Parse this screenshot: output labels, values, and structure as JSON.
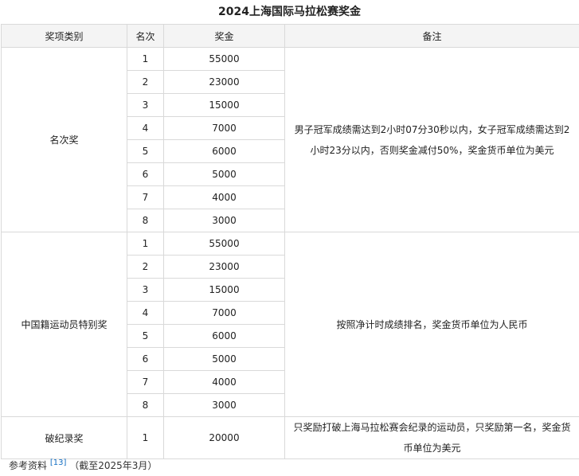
{
  "title": "2024上海国际马拉松赛奖金",
  "headers": {
    "category": "奖项类别",
    "rank": "名次",
    "prize": "奖金",
    "note": "备注"
  },
  "groups": [
    {
      "category": "名次奖",
      "note": "男子冠军成绩需达到2小时07分30秒以内，女子冠军成绩需达到2小时23分以内，否则奖金减付50%，奖金货币单位为美元",
      "rows": [
        {
          "rank": "1",
          "prize": "55000"
        },
        {
          "rank": "2",
          "prize": "23000"
        },
        {
          "rank": "3",
          "prize": "15000"
        },
        {
          "rank": "4",
          "prize": "7000"
        },
        {
          "rank": "5",
          "prize": "6000"
        },
        {
          "rank": "6",
          "prize": "5000"
        },
        {
          "rank": "7",
          "prize": "4000"
        },
        {
          "rank": "8",
          "prize": "3000"
        }
      ]
    },
    {
      "category": "中国籍运动员特别奖",
      "note": "按照净计时成绩排名，奖金货币单位为人民币",
      "rows": [
        {
          "rank": "1",
          "prize": "55000"
        },
        {
          "rank": "2",
          "prize": "23000"
        },
        {
          "rank": "3",
          "prize": "15000"
        },
        {
          "rank": "4",
          "prize": "7000"
        },
        {
          "rank": "5",
          "prize": "6000"
        },
        {
          "rank": "6",
          "prize": "5000"
        },
        {
          "rank": "7",
          "prize": "4000"
        },
        {
          "rank": "8",
          "prize": "3000"
        }
      ]
    },
    {
      "category": "破纪录奖",
      "note": "只奖励打破上海马拉松赛会纪录的运动员，只奖励第一名，奖金货币单位为美元",
      "rows": [
        {
          "rank": "1",
          "prize": "20000"
        }
      ]
    }
  ],
  "footnote": {
    "label": "参考资料",
    "ref": "[13]",
    "date_note": "（截至2025年3月）"
  }
}
